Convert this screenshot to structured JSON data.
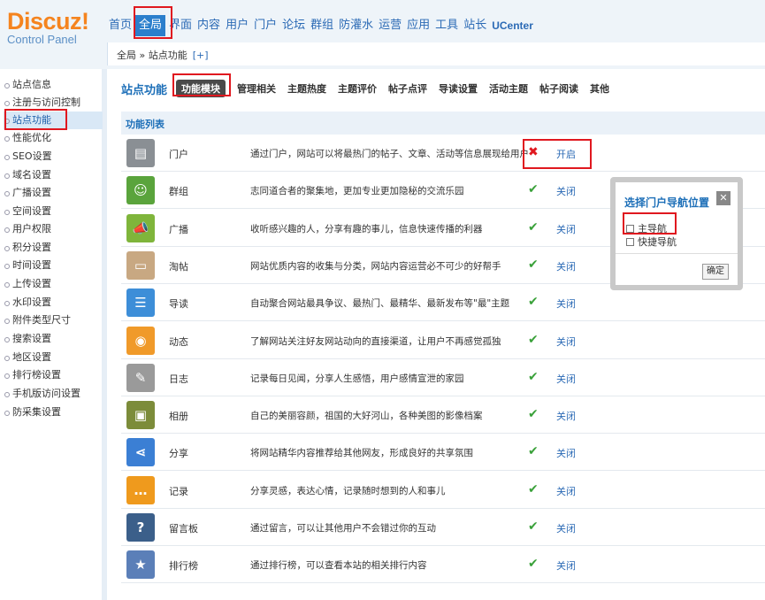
{
  "app": {
    "logo_main": "Discuz!",
    "logo_sub": "Control Panel"
  },
  "topnav": {
    "tabs": [
      "首页",
      "全局",
      "界面",
      "内容",
      "用户",
      "门户",
      "论坛",
      "群组",
      "防灌水",
      "运营",
      "应用",
      "工具",
      "站长",
      "UCenter"
    ]
  },
  "breadcrumb": {
    "path": "全局 » 站点功能",
    "add": "[+]"
  },
  "sidebar": {
    "items": [
      "站点信息",
      "注册与访问控制",
      "站点功能",
      "性能优化",
      "SEO设置",
      "域名设置",
      "广播设置",
      "空间设置",
      "用户权限",
      "积分设置",
      "时间设置",
      "上传设置",
      "水印设置",
      "附件类型尺寸",
      "搜索设置",
      "地区设置",
      "排行榜设置",
      "手机版访问设置",
      "防采集设置"
    ]
  },
  "subnav": {
    "title": "站点功能",
    "tabs": [
      "功能模块",
      "管理相关",
      "主题热度",
      "主题评价",
      "帖子点评",
      "导读设置",
      "活动主题",
      "帖子阅读",
      "其他"
    ]
  },
  "list": {
    "header": "功能列表",
    "rows": [
      {
        "name": "门户",
        "desc": "通过门户，网站可以将最热门的帖子、文章、活动等信息展现给用户",
        "status": "✖",
        "action": "开启",
        "icon": "portal-icon",
        "color": "#8a8f94"
      },
      {
        "name": "群组",
        "desc": "志同道合者的聚集地，更加专业更加隐秘的交流乐园",
        "status": "✔",
        "action": "关闭",
        "icon": "group-icon",
        "color": "#5aa43c"
      },
      {
        "name": "广播",
        "desc": "收听感兴趣的人，分享有趣的事儿，信息快速传播的利器",
        "status": "✔",
        "action": "关闭",
        "icon": "broadcast-icon",
        "color": "#7fb53b"
      },
      {
        "name": "淘帖",
        "desc": "网站优质内容的收集与分类，网站内容运营必不可少的好帮手",
        "status": "✔",
        "action": "关闭",
        "icon": "collection-icon",
        "color": "#c8a882"
      },
      {
        "name": "导读",
        "desc": "自动聚合网站最具争议、最热门、最精华、最新发布等\"最\"主题",
        "status": "✔",
        "action": "关闭",
        "icon": "guide-icon",
        "color": "#3d8ed8"
      },
      {
        "name": "动态",
        "desc": "了解网站关注好友网站动向的直接渠道，让用户不再感觉孤独",
        "status": "✔",
        "action": "关闭",
        "icon": "feed-icon",
        "color": "#f09a2a"
      },
      {
        "name": "日志",
        "desc": "记录每日见闻，分享人生感悟，用户感情宣泄的家园",
        "status": "✔",
        "action": "关闭",
        "icon": "blog-icon",
        "color": "#9a9a9a"
      },
      {
        "name": "相册",
        "desc": "自己的美丽容颜，祖国的大好河山，各种美图的影像档案",
        "status": "✔",
        "action": "关闭",
        "icon": "album-icon",
        "color": "#7c8c3a"
      },
      {
        "name": "分享",
        "desc": "将网站精华内容推荐给其他网友，形成良好的共享氛围",
        "status": "✔",
        "action": "关闭",
        "icon": "share-icon",
        "color": "#3b7fd4"
      },
      {
        "name": "记录",
        "desc": "分享灵感，表达心情，记录随时想到的人和事儿",
        "status": "✔",
        "action": "关闭",
        "icon": "doing-icon",
        "color": "#ef9a1d"
      },
      {
        "name": "留言板",
        "desc": "通过留言，可以让其他用户不会错过你的互动",
        "status": "✔",
        "action": "关闭",
        "icon": "wall-icon",
        "color": "#3b5f8a"
      },
      {
        "name": "排行榜",
        "desc": "通过排行榜，可以查看本站的相关排行内容",
        "status": "✔",
        "action": "关闭",
        "icon": "ranklist-icon",
        "color": "#5b7fb8"
      }
    ]
  },
  "popup": {
    "title": "选择门户导航位置",
    "close": "✕",
    "options": [
      "主导航",
      "快捷导航"
    ],
    "ok": "确定"
  }
}
